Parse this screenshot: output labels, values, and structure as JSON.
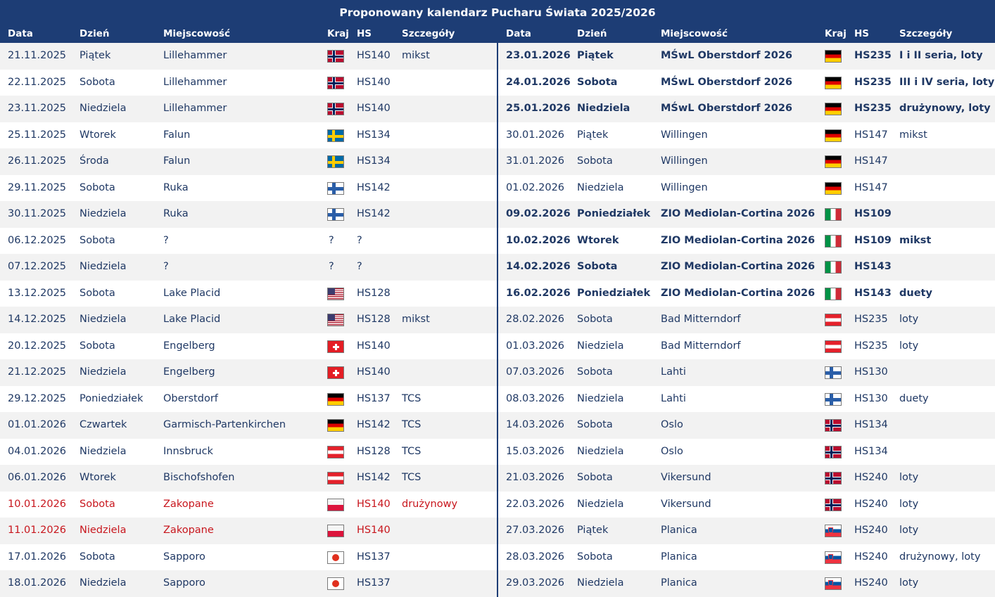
{
  "title": "Proponowany kalendarz Pucharu Świata 2025/2026",
  "headers": {
    "date": "Data",
    "day": "Dzień",
    "venue": "Miejscowość",
    "country": "Kraj",
    "hs": "HS",
    "details": "Szczegóły"
  },
  "colors": {
    "header_bg": "#1d3d75",
    "text": "#1f3864",
    "highlight_red": "#c8161d",
    "row_alt": "#f2f2f2"
  },
  "left_rows": [
    {
      "date": "21.11.2025",
      "day": "Piątek",
      "venue": "Lillehammer",
      "flag": "nor",
      "hs": "HS140",
      "details": "mikst",
      "style": ""
    },
    {
      "date": "22.11.2025",
      "day": "Sobota",
      "venue": "Lillehammer",
      "flag": "nor",
      "hs": "HS140",
      "details": "",
      "style": ""
    },
    {
      "date": "23.11.2025",
      "day": "Niedziela",
      "venue": "Lillehammer",
      "flag": "nor",
      "hs": "HS140",
      "details": "",
      "style": ""
    },
    {
      "date": "25.11.2025",
      "day": "Wtorek",
      "venue": "Falun",
      "flag": "swe",
      "hs": "HS134",
      "details": "",
      "style": ""
    },
    {
      "date": "26.11.2025",
      "day": "Środa",
      "venue": "Falun",
      "flag": "swe",
      "hs": "HS134",
      "details": "",
      "style": ""
    },
    {
      "date": "29.11.2025",
      "day": "Sobota",
      "venue": "Ruka",
      "flag": "fin",
      "hs": "HS142",
      "details": "",
      "style": ""
    },
    {
      "date": "30.11.2025",
      "day": "Niedziela",
      "venue": "Ruka",
      "flag": "fin",
      "hs": "HS142",
      "details": "",
      "style": ""
    },
    {
      "date": "06.12.2025",
      "day": "Sobota",
      "venue": "?",
      "flag": "unknown",
      "hs": "?",
      "details": "",
      "style": ""
    },
    {
      "date": "07.12.2025",
      "day": "Niedziela",
      "venue": "?",
      "flag": "unknown",
      "hs": "?",
      "details": "",
      "style": ""
    },
    {
      "date": "13.12.2025",
      "day": "Sobota",
      "venue": "Lake Placid",
      "flag": "usa",
      "hs": "HS128",
      "details": "",
      "style": ""
    },
    {
      "date": "14.12.2025",
      "day": "Niedziela",
      "venue": "Lake Placid",
      "flag": "usa",
      "hs": "HS128",
      "details": "mikst",
      "style": ""
    },
    {
      "date": "20.12.2025",
      "day": "Sobota",
      "venue": "Engelberg",
      "flag": "sui",
      "hs": "HS140",
      "details": "",
      "style": ""
    },
    {
      "date": "21.12.2025",
      "day": "Niedziela",
      "venue": "Engelberg",
      "flag": "sui",
      "hs": "HS140",
      "details": "",
      "style": ""
    },
    {
      "date": "29.12.2025",
      "day": "Poniedziałek",
      "venue": "Oberstdorf",
      "flag": "ger",
      "hs": "HS137",
      "details": "TCS",
      "style": ""
    },
    {
      "date": "01.01.2026",
      "day": "Czwartek",
      "venue": "Garmisch-Partenkirchen",
      "flag": "ger",
      "hs": "HS142",
      "details": "TCS",
      "style": ""
    },
    {
      "date": "04.01.2026",
      "day": "Niedziela",
      "venue": "Innsbruck",
      "flag": "aut",
      "hs": "HS128",
      "details": "TCS",
      "style": ""
    },
    {
      "date": "06.01.2026",
      "day": "Wtorek",
      "venue": "Bischofshofen",
      "flag": "aut",
      "hs": "HS142",
      "details": "TCS",
      "style": ""
    },
    {
      "date": "10.01.2026",
      "day": "Sobota",
      "venue": "Zakopane",
      "flag": "pol",
      "hs": "HS140",
      "details": "drużynowy",
      "style": "red"
    },
    {
      "date": "11.01.2026",
      "day": "Niedziela",
      "venue": "Zakopane",
      "flag": "pol",
      "hs": "HS140",
      "details": "",
      "style": "red"
    },
    {
      "date": "17.01.2026",
      "day": "Sobota",
      "venue": "Sapporo",
      "flag": "jpn",
      "hs": "HS137",
      "details": "",
      "style": ""
    },
    {
      "date": "18.01.2026",
      "day": "Niedziela",
      "venue": "Sapporo",
      "flag": "jpn",
      "hs": "HS137",
      "details": "",
      "style": ""
    }
  ],
  "right_rows": [
    {
      "date": "23.01.2026",
      "day": "Piątek",
      "venue": "MŚwL Oberstdorf 2026",
      "flag": "ger",
      "hs": "HS235",
      "details": "I i II seria, loty",
      "style": "bold"
    },
    {
      "date": "24.01.2026",
      "day": "Sobota",
      "venue": "MŚwL Oberstdorf 2026",
      "flag": "ger",
      "hs": "HS235",
      "details": "III i IV seria, loty",
      "style": "bold"
    },
    {
      "date": "25.01.2026",
      "day": "Niedziela",
      "venue": "MŚwL Oberstdorf 2026",
      "flag": "ger",
      "hs": "HS235",
      "details": "drużynowy, loty",
      "style": "bold"
    },
    {
      "date": "30.01.2026",
      "day": "Piątek",
      "venue": "Willingen",
      "flag": "ger",
      "hs": "HS147",
      "details": "mikst",
      "style": ""
    },
    {
      "date": "31.01.2026",
      "day": "Sobota",
      "venue": "Willingen",
      "flag": "ger",
      "hs": "HS147",
      "details": "",
      "style": ""
    },
    {
      "date": "01.02.2026",
      "day": "Niedziela",
      "venue": "Willingen",
      "flag": "ger",
      "hs": "HS147",
      "details": "",
      "style": ""
    },
    {
      "date": "09.02.2026",
      "day": "Poniedziałek",
      "venue": "ZIO Mediolan-Cortina 2026",
      "flag": "ita",
      "hs": "HS109",
      "details": "",
      "style": "bold"
    },
    {
      "date": "10.02.2026",
      "day": "Wtorek",
      "venue": "ZIO Mediolan-Cortina 2026",
      "flag": "ita",
      "hs": "HS109",
      "details": "mikst",
      "style": "bold"
    },
    {
      "date": "14.02.2026",
      "day": "Sobota",
      "venue": "ZIO Mediolan-Cortina 2026",
      "flag": "ita",
      "hs": "HS143",
      "details": "",
      "style": "bold"
    },
    {
      "date": "16.02.2026",
      "day": "Poniedziałek",
      "venue": "ZIO Mediolan-Cortina 2026",
      "flag": "ita",
      "hs": "HS143",
      "details": "duety",
      "style": "bold"
    },
    {
      "date": "28.02.2026",
      "day": "Sobota",
      "venue": "Bad Mitterndorf",
      "flag": "aut",
      "hs": "HS235",
      "details": "loty",
      "style": ""
    },
    {
      "date": "01.03.2026",
      "day": "Niedziela",
      "venue": "Bad Mitterndorf",
      "flag": "aut",
      "hs": "HS235",
      "details": "loty",
      "style": ""
    },
    {
      "date": "07.03.2026",
      "day": "Sobota",
      "venue": "Lahti",
      "flag": "fin",
      "hs": "HS130",
      "details": "",
      "style": ""
    },
    {
      "date": "08.03.2026",
      "day": "Niedziela",
      "venue": "Lahti",
      "flag": "fin",
      "hs": "HS130",
      "details": "duety",
      "style": ""
    },
    {
      "date": "14.03.2026",
      "day": "Sobota",
      "venue": "Oslo",
      "flag": "nor",
      "hs": "HS134",
      "details": "",
      "style": ""
    },
    {
      "date": "15.03.2026",
      "day": "Niedziela",
      "venue": "Oslo",
      "flag": "nor",
      "hs": "HS134",
      "details": "",
      "style": ""
    },
    {
      "date": "21.03.2026",
      "day": "Sobota",
      "venue": "Vikersund",
      "flag": "nor",
      "hs": "HS240",
      "details": "loty",
      "style": ""
    },
    {
      "date": "22.03.2026",
      "day": "Niedziela",
      "venue": "Vikersund",
      "flag": "nor",
      "hs": "HS240",
      "details": "loty",
      "style": ""
    },
    {
      "date": "27.03.2026",
      "day": "Piątek",
      "venue": "Planica",
      "flag": "slo",
      "hs": "HS240",
      "details": "loty",
      "style": ""
    },
    {
      "date": "28.03.2026",
      "day": "Sobota",
      "venue": "Planica",
      "flag": "slo",
      "hs": "HS240",
      "details": "drużynowy, loty",
      "style": ""
    },
    {
      "date": "29.03.2026",
      "day": "Niedziela",
      "venue": "Planica",
      "flag": "slo",
      "hs": "HS240",
      "details": "loty",
      "style": ""
    }
  ]
}
